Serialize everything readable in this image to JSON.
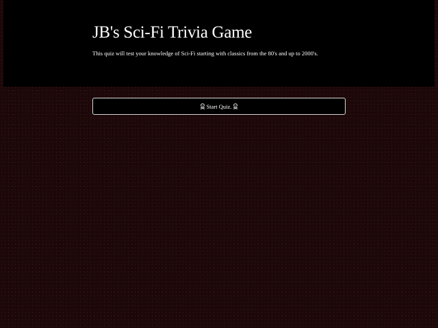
{
  "header": {
    "title": "JB's Sci-Fi Trivia Game",
    "subtitle": "This quiz will test your knowledge of Sci-Fi starting with classics from the 80's and up to 2000's."
  },
  "start_button": {
    "label": "Start Quiz.",
    "icon_left": "skull-crossbones-icon",
    "icon_right": "skull-crossbones-icon"
  },
  "colors": {
    "page_background": "#1c0809",
    "header_background": "#000000",
    "text": "#ffffff",
    "button_border": "#d9d9d9"
  }
}
